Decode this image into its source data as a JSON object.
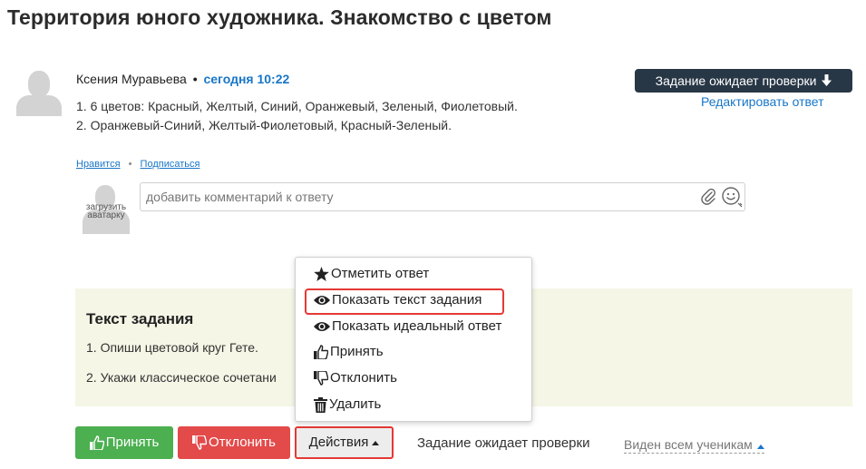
{
  "page": {
    "title": "Территория юного художника. Знакомство с цветом"
  },
  "answer": {
    "author": "Ксения Муравьева",
    "bullet": "•",
    "timestamp": "сегодня 10:22",
    "lines": [
      "1. 6 цветов: Красный, Желтый, Синий, Оранжевый, Зеленый, Фиолетовый.",
      "2. Оранжевый-Синий, Желтый-Фиолетовый, Красный-Зеленый."
    ],
    "status_badge": "Задание ожидает проверки",
    "edit_link": "Редактировать ответ"
  },
  "social": {
    "like": "Нравится",
    "separator": "•",
    "subscribe": "Подписаться"
  },
  "comment": {
    "avatar_label": "загрузить аватарку",
    "placeholder": "добавить комментарий к ответу"
  },
  "task": {
    "title": "Текст задания",
    "line1": "1. Опиши цветовой круг Гете.",
    "line2": "2. Укажи классическое сочетани"
  },
  "menu": {
    "items": [
      {
        "label": "Отметить ответ",
        "icon": "star-icon"
      },
      {
        "label": "Показать текст задания",
        "icon": "eye-icon"
      },
      {
        "label": "Показать идеальный ответ",
        "icon": "eye-icon"
      },
      {
        "label": "Принять",
        "icon": "thumbs-up-icon"
      },
      {
        "label": "Отклонить",
        "icon": "thumbs-down-icon"
      },
      {
        "label": "Удалить",
        "icon": "trash-icon"
      }
    ]
  },
  "actions": {
    "accept": "Принять",
    "reject": "Отклонить",
    "actions": "Действия",
    "status": "Задание ожидает проверки",
    "visibility": "Виден всем ученикам"
  },
  "colors": {
    "accent_blue": "#1976c7",
    "badge_dark": "#283746",
    "accept_green": "#4caf50",
    "reject_red": "#e34a4a",
    "highlight_red": "#e53935",
    "task_panel_bg": "#f5f6e6"
  }
}
